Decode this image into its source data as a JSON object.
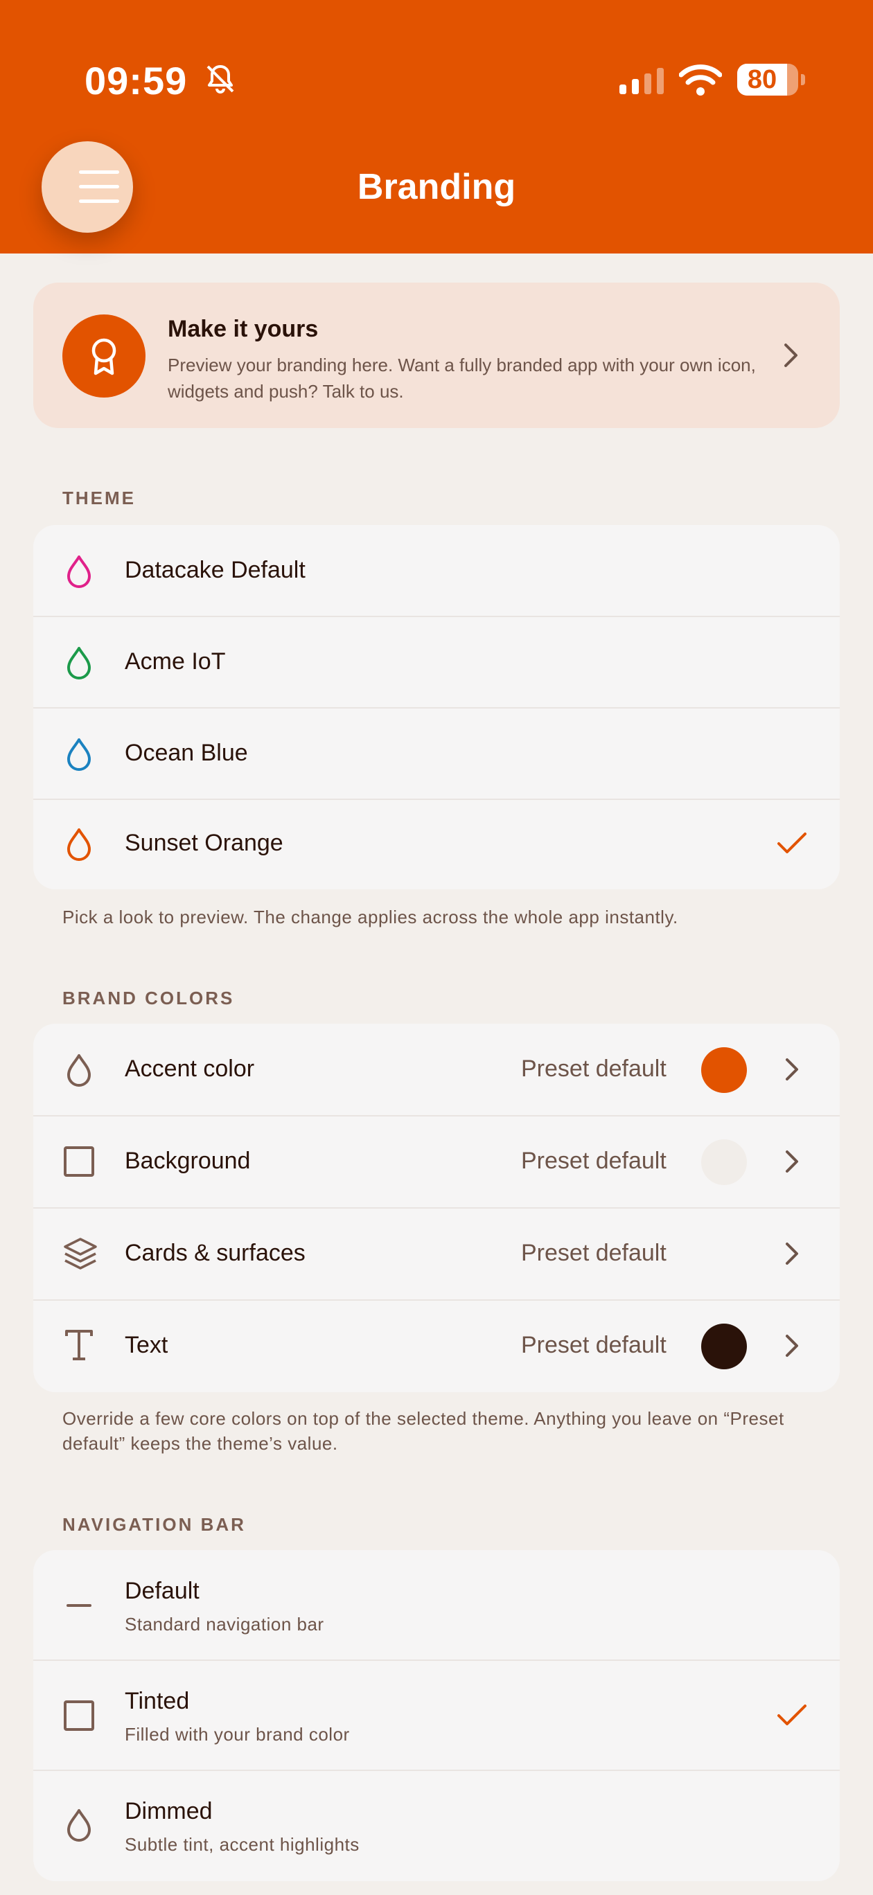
{
  "status_bar": {
    "time": "09:59",
    "battery": "80",
    "battery_level": 0.8,
    "icons": [
      "bell-slash-icon",
      "signal-icon",
      "wifi-icon",
      "battery-icon"
    ]
  },
  "header": {
    "title": "Branding",
    "menu_icon": "hamburger-icon",
    "background_color": "#e25300"
  },
  "promo": {
    "title": "Make it yours",
    "body": "Preview your branding here. Want a fully branded app with your own icon, widgets and push? Talk to us.",
    "icon": "award-ribbon-icon"
  },
  "theme": {
    "label": "THEME",
    "items": [
      {
        "label": "Datacake Default",
        "color": "#e0218a",
        "selected": false
      },
      {
        "label": "Acme IoT",
        "color": "#1c9a4a",
        "selected": false
      },
      {
        "label": "Ocean Blue",
        "color": "#1b82c0",
        "selected": false
      },
      {
        "label": "Sunset Orange",
        "color": "#e25300",
        "selected": true
      }
    ],
    "helper": "Pick a look to preview. The change applies across the whole app instantly."
  },
  "brand_colors": {
    "label": "BRAND COLORS",
    "items": [
      {
        "label": "Accent color",
        "value": "Preset default",
        "swatch": "#e25300",
        "icon": "drop-icon"
      },
      {
        "label": "Background",
        "value": "Preset default",
        "swatch": "#f3efeb",
        "icon": "square-icon"
      },
      {
        "label": "Cards & surfaces",
        "value": "Preset default",
        "swatch": "",
        "icon": "layers-icon"
      },
      {
        "label": "Text",
        "value": "Preset default",
        "swatch": "#2a1209",
        "icon": "text-icon"
      }
    ],
    "helper": "Override a few core colors on top of the selected theme. Anything you leave on “Preset default” keeps the theme’s value."
  },
  "navigation_bar": {
    "label": "NAVIGATION BAR",
    "items": [
      {
        "label": "Default",
        "sub": "Standard navigation bar",
        "selected": false,
        "icon": "minus-icon"
      },
      {
        "label": "Tinted",
        "sub": "Filled with your brand color",
        "selected": true,
        "icon": "square-icon"
      },
      {
        "label": "Dimmed",
        "sub": "Subtle tint, accent highlights",
        "selected": false,
        "icon": "drop-icon"
      }
    ]
  }
}
